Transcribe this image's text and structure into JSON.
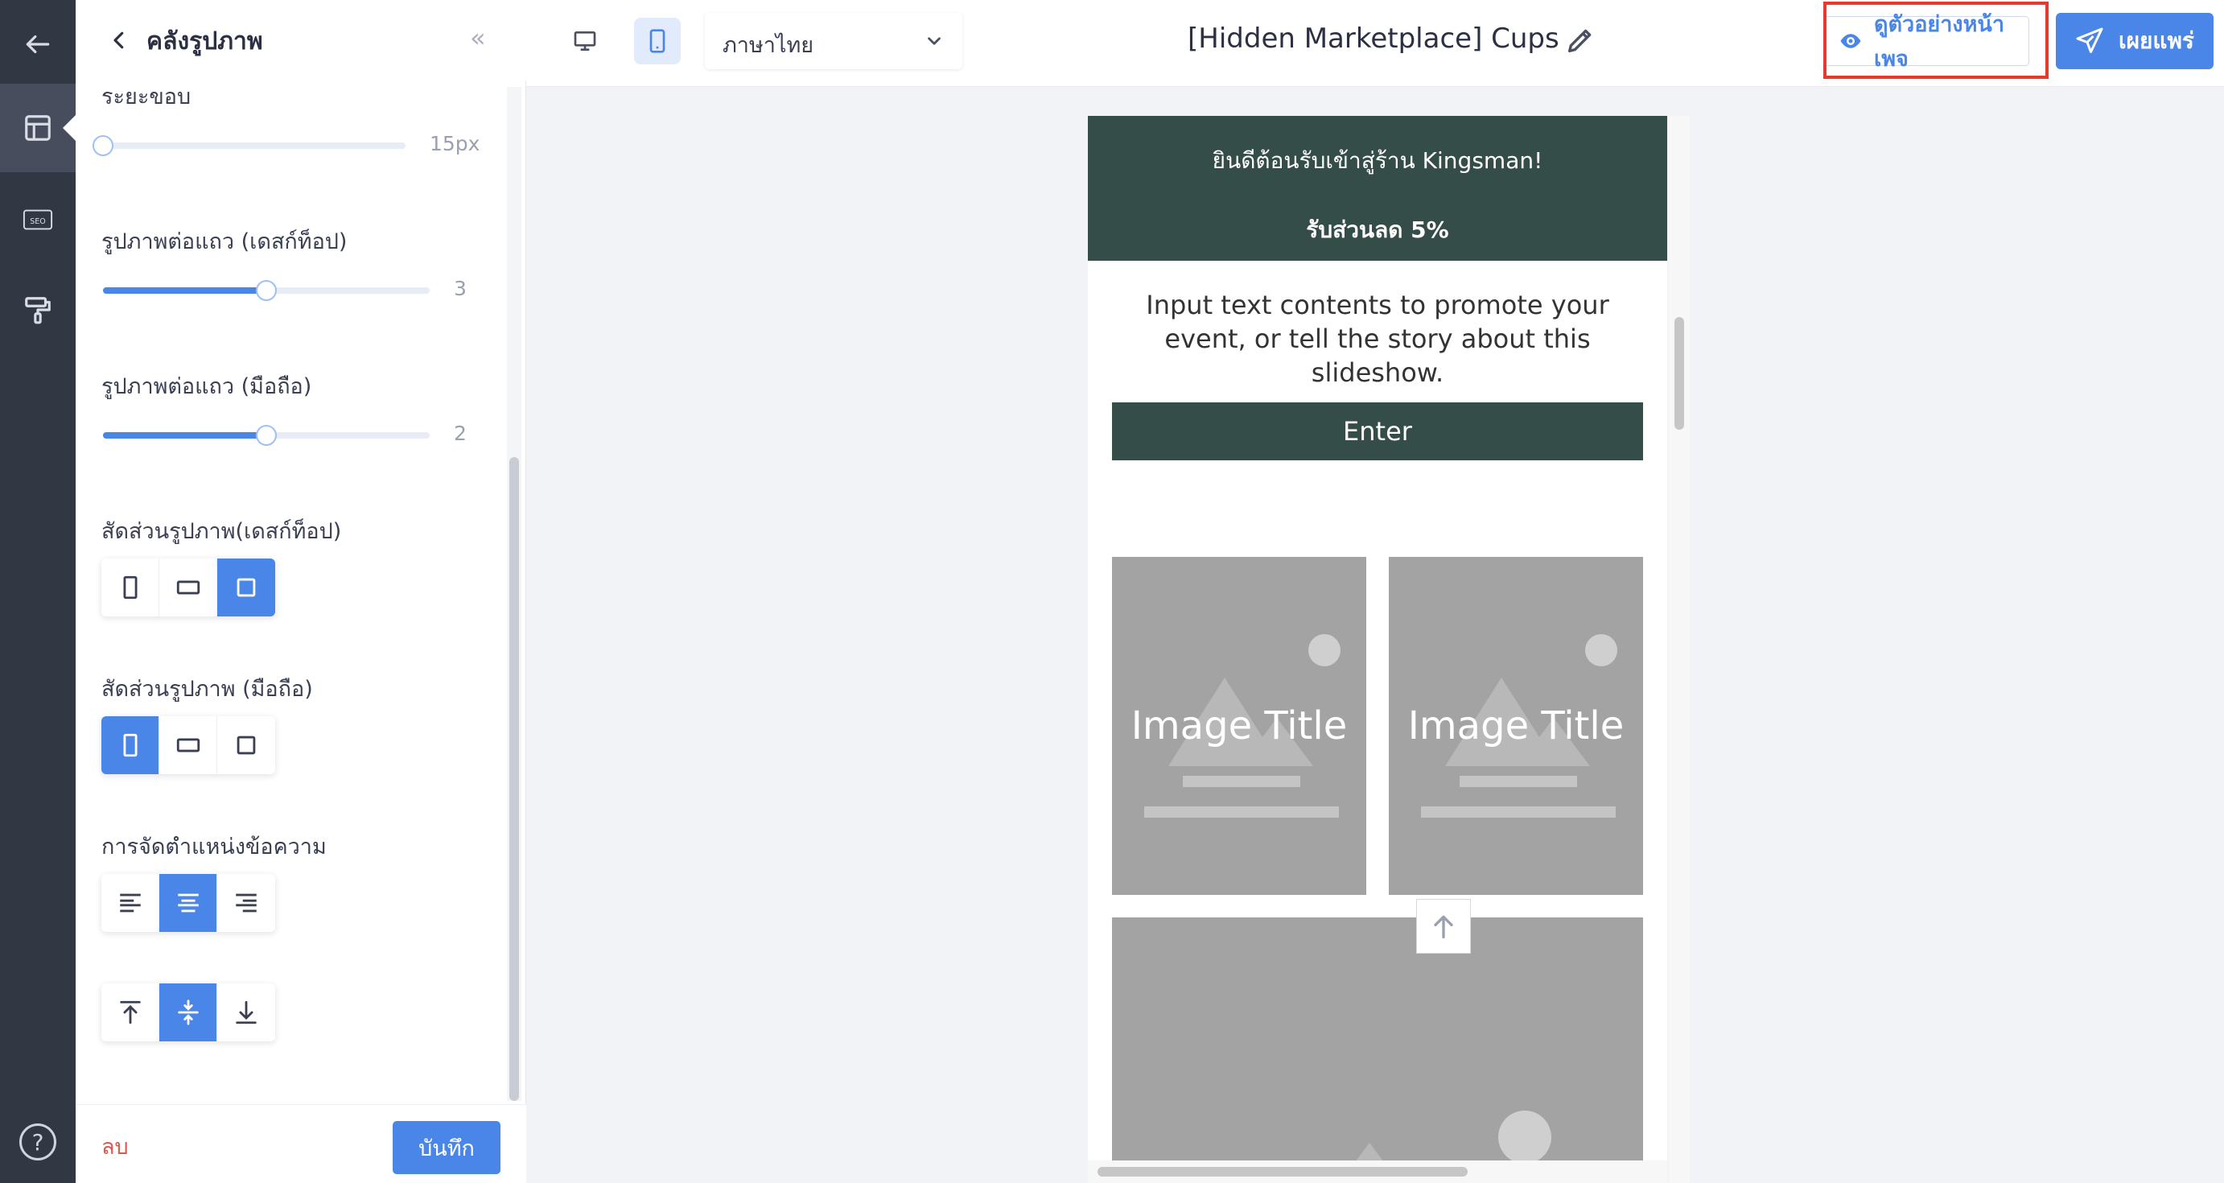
{
  "rail": {
    "items": [
      "back-icon",
      "layout-icon",
      "seo-icon",
      "paint-roller-icon"
    ],
    "seo_text": "SEO",
    "help_icon": "help-icon",
    "help_glyph": "?"
  },
  "panel": {
    "title": "คลังรูปภาพ",
    "collapse_glyph": "«",
    "spacing": {
      "label": "ระยะขอบ",
      "value": "15px",
      "level": 0
    },
    "per_row_desktop": {
      "label": "รูปภาพต่อแถว (เดสก์ท็อป)",
      "value": "3",
      "level": 0.5
    },
    "per_row_mobile": {
      "label": "รูปภาพต่อแถว (มือถือ)",
      "value": "2",
      "level": 0.5
    },
    "ratio_desktop": {
      "label": "สัดส่วนรูปภาพ(เดสก์ท็อป)",
      "options": [
        "portrait",
        "landscape",
        "square"
      ],
      "selected": "square"
    },
    "ratio_mobile": {
      "label": "สัดส่วนรูปภาพ (มือถือ)",
      "options": [
        "portrait",
        "landscape",
        "square"
      ],
      "selected": "portrait"
    },
    "text_align": {
      "label": "การจัดตำแหน่งข้อความ",
      "options": [
        "left",
        "center",
        "right"
      ],
      "selected": "center"
    },
    "vertical_align": {
      "options": [
        "top",
        "middle",
        "bottom"
      ],
      "selected": "middle"
    },
    "delete_label": "ลบ",
    "save_label": "บันทึก"
  },
  "topbar": {
    "devices": [
      "desktop",
      "mobile"
    ],
    "selected_device": "mobile",
    "language": "ภาษาไทย",
    "page_title": "[Hidden Marketplace] Cups",
    "preview_label": "ดูตัวอย่างหน้าเพจ",
    "publish_label": "เผยแพร่"
  },
  "preview": {
    "banner_line1": "ยินดีต้อนรับเข้าสู่ร้าน Kingsman!",
    "banner_line2": "รับส่วนลด 5%",
    "promo_text": "Input text contents to promote your event, or tell the story about this slideshow.",
    "enter_label": "Enter",
    "tile_1_title": "Image Title",
    "tile_2_title": "Image Title"
  },
  "colors": {
    "accent": "#4a86e8",
    "rail_bg": "#323744",
    "banner_bg": "#344d48",
    "highlight": "#e53b2f",
    "placeholder": "#a3a3a3"
  }
}
